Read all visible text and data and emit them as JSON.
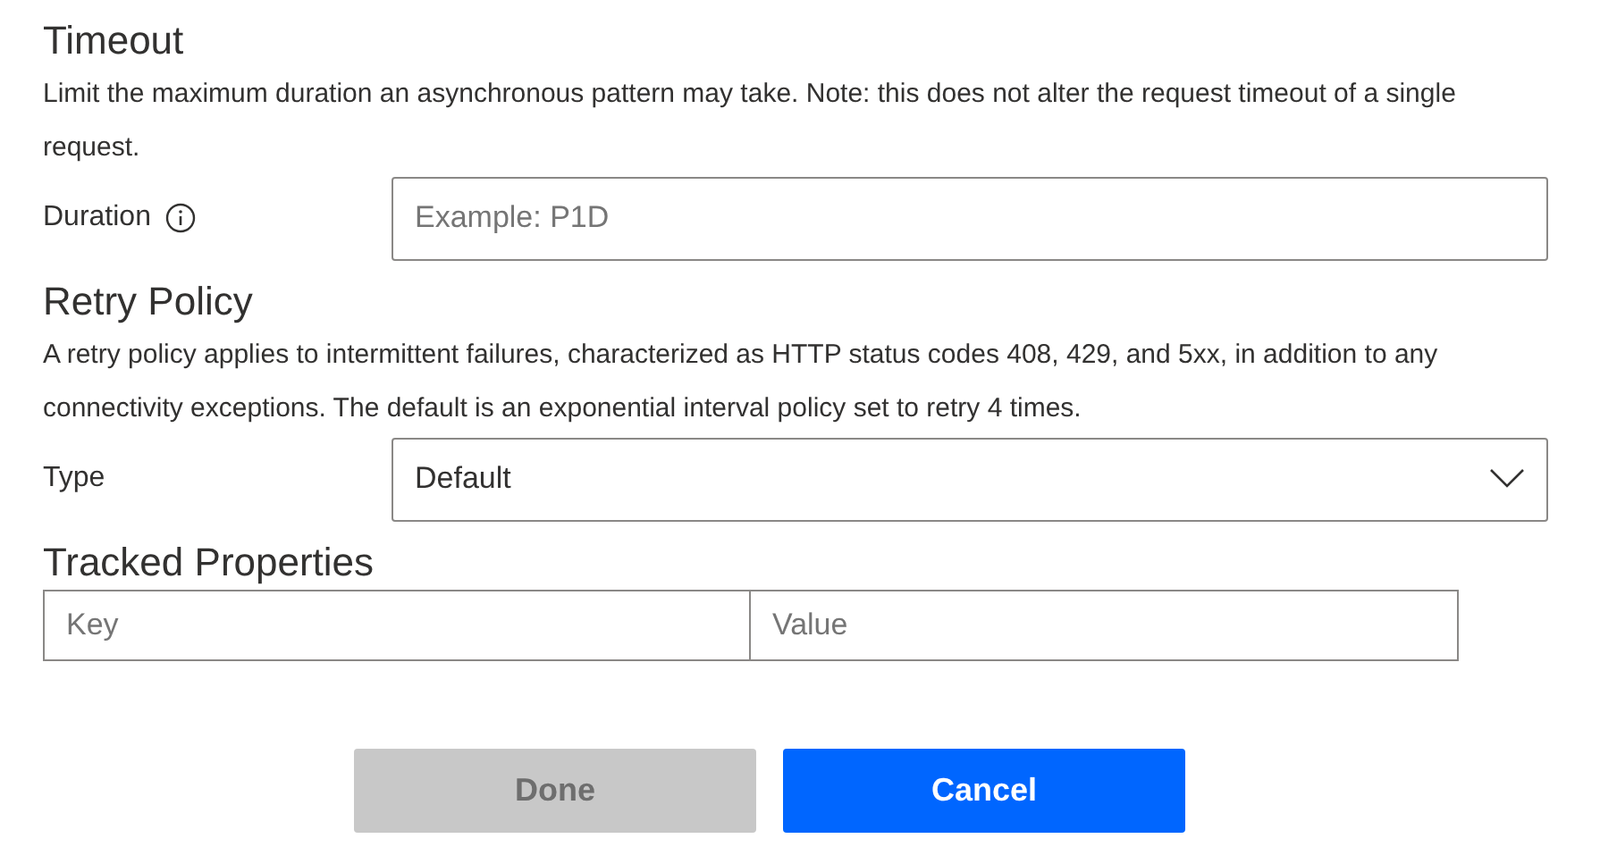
{
  "sections": [
    {
      "title": "Timeout",
      "description": "Limit the maximum duration an asynchronous pattern may take. Note: this does not alter the request timeout of a single request.",
      "field": {
        "kind": "text",
        "label": "Duration",
        "info": true,
        "placeholder": "Example: P1D"
      }
    },
    {
      "title": "Retry Policy",
      "description": "A retry policy applies to intermittent failures, characterized as HTTP status codes 408, 429, and 5xx, in addition to any connectivity exceptions. The default is an exponential interval policy set to retry 4 times.",
      "field": {
        "kind": "select",
        "label": "Type",
        "info": false,
        "value": "Default"
      }
    }
  ],
  "tracked_properties": {
    "title": "Tracked Properties",
    "key_placeholder": "Key",
    "value_placeholder": "Value"
  },
  "buttons": [
    {
      "label": "Done",
      "disabled": true
    },
    {
      "label": "Cancel",
      "disabled": false
    }
  ]
}
